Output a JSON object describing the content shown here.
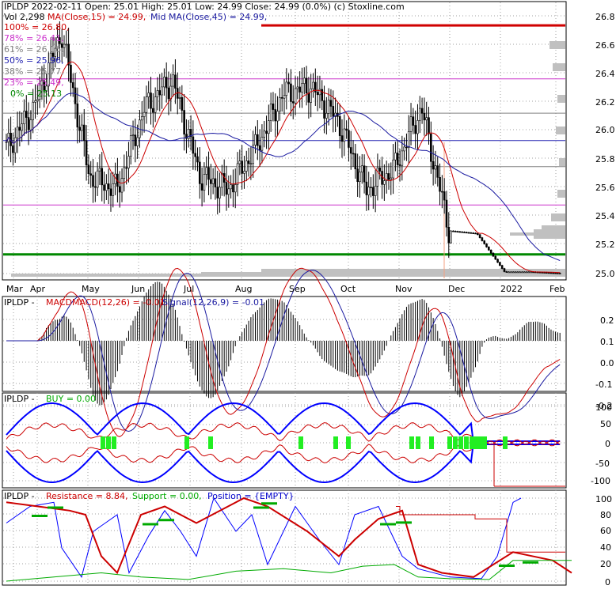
{
  "colors": {
    "frame": "#000000",
    "grid": "#a0a0a0",
    "candle": "#000000",
    "ma_fast": "#cc0000",
    "ma_mid": "#1a1aa0",
    "fib_line_top": "#d00000",
    "fib_line_mid": "#cc33cc",
    "fib_line_blue": "#2020b0",
    "fib_line_bottom": "#008800",
    "volume_profile": "#c0c0c0",
    "buy_green": "#22ee22",
    "support_green": "#00aa00",
    "position_blue": "#0000ff"
  },
  "price_panel": {
    "header_line1": "IPLDP  2022-02-11 Open: 25.01  High: 25.01  Low: 24.99  Close: 24.99 (0.0%)  (c) Stoxline.com",
    "vol_label": "Vol 2,298",
    "ma_fast_label": "MA(Close,15) = 24.99,",
    "ma_mid_label": "Mid MA(Close,45) = 24.99,",
    "fib_labels": [
      {
        "text": "100% = 26.80,",
        "color": "#d00000"
      },
      {
        "text": "78% = 26.41,",
        "color": "#cc33cc"
      },
      {
        "text": "61% = 26.16,",
        "color": "#808080"
      },
      {
        "text": "50% = 25.96,",
        "color": "#2020b0"
      },
      {
        "text": "38% = 25.77,",
        "color": "#808080"
      },
      {
        "text": "23% = 25.49,",
        "color": "#cc33cc"
      },
      {
        "text": "0% = 25.13",
        "color": "#008800"
      }
    ],
    "y_ticks": [
      "26.8",
      "26.6",
      "26.4",
      "26.2",
      "26.0",
      "25.8",
      "25.6",
      "25.4",
      "25.2",
      "25.0"
    ],
    "x_ticks": [
      "Mar",
      "Apr",
      "May",
      "Jun",
      "Jul",
      "Aug",
      "Sep",
      "Oct",
      "Nov",
      "Dec",
      "2022",
      "Feb"
    ]
  },
  "macd_panel": {
    "label_prefix": "IPLDP - ",
    "label_macd": "MACDMACD(12,26) = -0.01,",
    "label_signal": "Signal(12,26,9) = -0.01",
    "y_ticks": [
      "0.2",
      "0.1",
      "0.0",
      "-0.1",
      "-0.2"
    ]
  },
  "buy_panel": {
    "label_prefix": "IPLDP - ",
    "label_buy": "BUY = 0.00",
    "y_ticks": [
      "100",
      "50",
      "0",
      "-50",
      "-100"
    ]
  },
  "rsp_panel": {
    "label_prefix": "IPLDP - ",
    "label_resistance": "Resistance = 8.84,",
    "label_support": "Support = 0.00,",
    "label_position": "Position = {EMPTY}",
    "y_ticks": [
      "100",
      "80",
      "60",
      "40",
      "20",
      "0"
    ]
  },
  "chart_data": [
    {
      "type": "candlestick",
      "title": "IPLDP  2022-02-11 Open: 25.01  High: 25.01  Low: 24.99  Close: 24.99 (0.0%)  (c) Stoxline.com",
      "ylim": [
        24.99,
        26.87
      ],
      "x_categories": [
        "Mar",
        "Apr",
        "May",
        "Jun",
        "Jul",
        "Aug",
        "Sep",
        "Oct",
        "Nov",
        "Dec",
        "2022",
        "Feb"
      ],
      "close_path": [
        [
          "Mar",
          25.9
        ],
        [
          "Apr",
          26.2
        ],
        [
          "Apr-late",
          26.75
        ],
        [
          "May",
          25.7
        ],
        [
          "May-late",
          25.6
        ],
        [
          "Jun",
          26.2
        ],
        [
          "Jun-late",
          26.4
        ],
        [
          "Jul",
          25.7
        ],
        [
          "Jul-late",
          25.6
        ],
        [
          "Aug",
          25.9
        ],
        [
          "Aug-late",
          26.3
        ],
        [
          "Sep",
          26.35
        ],
        [
          "Sep-late",
          26.1
        ],
        [
          "Oct",
          25.6
        ],
        [
          "Oct-late",
          25.75
        ],
        [
          "Nov",
          26.2
        ],
        [
          "Nov-mid",
          25.3
        ],
        [
          "Nov-late",
          25.28
        ],
        [
          "Dec",
          25.0
        ],
        [
          "2022",
          25.0
        ],
        [
          "Feb",
          24.99
        ]
      ],
      "series": [
        {
          "name": "MA(Close,15)",
          "last": 24.99
        },
        {
          "name": "Mid MA(Close,45)",
          "last": 24.99
        }
      ],
      "fibonacci": [
        {
          "level": "100%",
          "value": 26.8
        },
        {
          "level": "78%",
          "value": 26.41
        },
        {
          "level": "61%",
          "value": 26.16
        },
        {
          "level": "50%",
          "value": 25.96
        },
        {
          "level": "38%",
          "value": 25.77
        },
        {
          "level": "23%",
          "value": 25.49
        },
        {
          "level": "0%",
          "value": 25.13
        }
      ],
      "volume": 2298
    },
    {
      "type": "line",
      "title": "MACD(12,26)",
      "ylim": [
        -0.25,
        0.25
      ],
      "series": [
        {
          "name": "MACD(12,26)",
          "last": -0.01
        },
        {
          "name": "Signal(12,26,9)",
          "last": -0.01
        }
      ]
    },
    {
      "type": "line",
      "title": "BUY",
      "ylim": [
        -120,
        120
      ],
      "series": [
        {
          "name": "BUY",
          "last": 0.0
        }
      ]
    },
    {
      "type": "line",
      "title": "Resistance / Support / Position",
      "ylim": [
        0,
        100
      ],
      "series": [
        {
          "name": "Resistance",
          "last": 8.84
        },
        {
          "name": "Support",
          "last": 0.0
        },
        {
          "name": "Position",
          "last": "{EMPTY}"
        }
      ]
    }
  ]
}
